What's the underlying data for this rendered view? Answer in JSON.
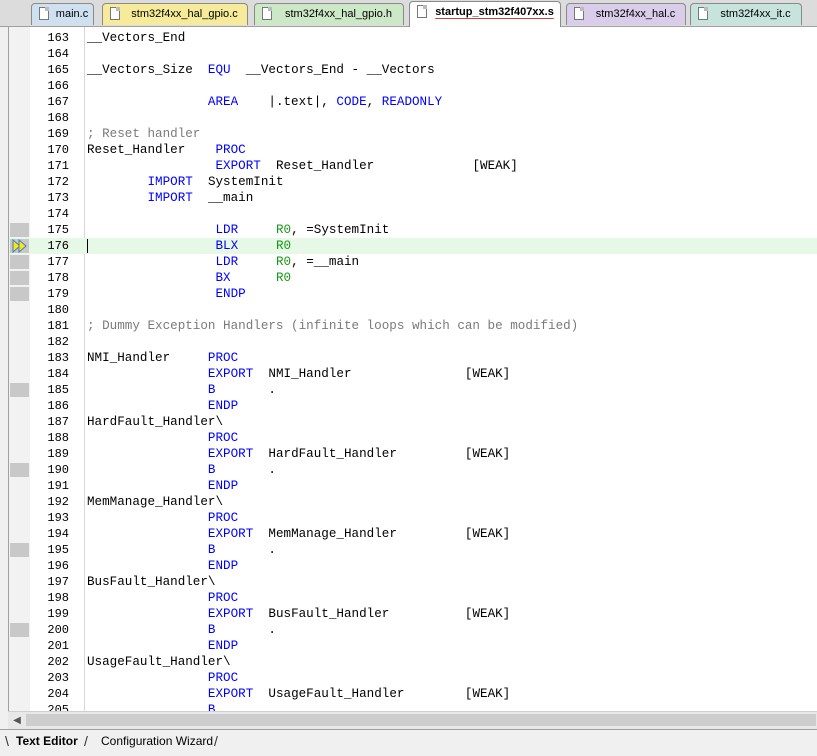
{
  "tabs": [
    {
      "label": "main.c",
      "color": "#cfe0f0",
      "active": false
    },
    {
      "label": "stm32f4xx_hal_gpio.c",
      "color": "#f5eb9a",
      "active": false
    },
    {
      "label": "stm32f4xx_hal_gpio.h",
      "color": "#cde8c6",
      "active": false
    },
    {
      "label": "startup_stm32f407xx.s",
      "color": "#ffffff",
      "active": true
    },
    {
      "label": "stm32f4xx_hal.c",
      "color": "#d9cdea",
      "active": false
    },
    {
      "label": "stm32f4xx_it.c",
      "color": "#c7e4dc",
      "active": false
    }
  ],
  "editor": {
    "current_line": 176,
    "lines": [
      {
        "n": "163",
        "t": [
          [
            "",
            "__Vectors_End"
          ]
        ]
      },
      {
        "n": "164",
        "t": []
      },
      {
        "n": "165",
        "t": [
          [
            "",
            "__Vectors_Size  "
          ],
          [
            "kw",
            "EQU"
          ],
          [
            "",
            "  __Vectors_End - __Vectors"
          ]
        ]
      },
      {
        "n": "166",
        "t": []
      },
      {
        "n": "167",
        "t": [
          [
            "",
            "                "
          ],
          [
            "kw",
            "AREA"
          ],
          [
            "",
            "    |.text|, "
          ],
          [
            "kw",
            "CODE"
          ],
          [
            "",
            ", "
          ],
          [
            "kw",
            "READONLY"
          ]
        ]
      },
      {
        "n": "168",
        "t": []
      },
      {
        "n": "169",
        "t": [
          [
            "cm",
            "; Reset handler"
          ]
        ]
      },
      {
        "n": "170",
        "t": [
          [
            "",
            "Reset_Handler    "
          ],
          [
            "kw",
            "PROC"
          ]
        ]
      },
      {
        "n": "171",
        "t": [
          [
            "",
            "                 "
          ],
          [
            "kw",
            "EXPORT"
          ],
          [
            "",
            "  Reset_Handler             [WEAK]"
          ]
        ]
      },
      {
        "n": "172",
        "t": [
          [
            "",
            "        "
          ],
          [
            "kw",
            "IMPORT"
          ],
          [
            "",
            "  SystemInit"
          ]
        ]
      },
      {
        "n": "173",
        "t": [
          [
            "",
            "        "
          ],
          [
            "kw",
            "IMPORT"
          ],
          [
            "",
            "  __main"
          ]
        ]
      },
      {
        "n": "174",
        "t": []
      },
      {
        "n": "175",
        "bp": true,
        "t": [
          [
            "",
            "                 "
          ],
          [
            "kw",
            "LDR"
          ],
          [
            "",
            "     "
          ],
          [
            "reg",
            "R0"
          ],
          [
            "",
            ", =SystemInit"
          ]
        ]
      },
      {
        "n": "176",
        "bp": true,
        "t": [
          [
            "",
            "                 "
          ],
          [
            "kw",
            "BLX"
          ],
          [
            "",
            "     "
          ],
          [
            "reg",
            "R0"
          ]
        ]
      },
      {
        "n": "177",
        "bp": true,
        "t": [
          [
            "",
            "                 "
          ],
          [
            "kw",
            "LDR"
          ],
          [
            "",
            "     "
          ],
          [
            "reg",
            "R0"
          ],
          [
            "",
            ", =__main"
          ]
        ]
      },
      {
        "n": "178",
        "bp": true,
        "t": [
          [
            "",
            "                 "
          ],
          [
            "kw",
            "BX"
          ],
          [
            "",
            "      "
          ],
          [
            "reg",
            "R0"
          ]
        ]
      },
      {
        "n": "179",
        "bp": true,
        "t": [
          [
            "",
            "                 "
          ],
          [
            "kw",
            "ENDP"
          ]
        ]
      },
      {
        "n": "180",
        "t": []
      },
      {
        "n": "181",
        "t": [
          [
            "cm",
            "; Dummy Exception Handlers (infinite loops which can be modified)"
          ]
        ]
      },
      {
        "n": "182",
        "t": []
      },
      {
        "n": "183",
        "t": [
          [
            "",
            "NMI_Handler     "
          ],
          [
            "kw",
            "PROC"
          ]
        ]
      },
      {
        "n": "184",
        "t": [
          [
            "",
            "                "
          ],
          [
            "kw",
            "EXPORT"
          ],
          [
            "",
            "  NMI_Handler               [WEAK]"
          ]
        ]
      },
      {
        "n": "185",
        "bp": true,
        "t": [
          [
            "",
            "                "
          ],
          [
            "kw",
            "B"
          ],
          [
            "",
            "       ."
          ]
        ]
      },
      {
        "n": "186",
        "t": [
          [
            "",
            "                "
          ],
          [
            "kw",
            "ENDP"
          ]
        ]
      },
      {
        "n": "187",
        "t": [
          [
            "",
            "HardFault_Handler\\"
          ]
        ]
      },
      {
        "n": "188",
        "t": [
          [
            "",
            "                "
          ],
          [
            "kw",
            "PROC"
          ]
        ]
      },
      {
        "n": "189",
        "t": [
          [
            "",
            "                "
          ],
          [
            "kw",
            "EXPORT"
          ],
          [
            "",
            "  HardFault_Handler         [WEAK]"
          ]
        ]
      },
      {
        "n": "190",
        "bp": true,
        "t": [
          [
            "",
            "                "
          ],
          [
            "kw",
            "B"
          ],
          [
            "",
            "       ."
          ]
        ]
      },
      {
        "n": "191",
        "t": [
          [
            "",
            "                "
          ],
          [
            "kw",
            "ENDP"
          ]
        ]
      },
      {
        "n": "192",
        "t": [
          [
            "",
            "MemManage_Handler\\"
          ]
        ]
      },
      {
        "n": "193",
        "t": [
          [
            "",
            "                "
          ],
          [
            "kw",
            "PROC"
          ]
        ]
      },
      {
        "n": "194",
        "t": [
          [
            "",
            "                "
          ],
          [
            "kw",
            "EXPORT"
          ],
          [
            "",
            "  MemManage_Handler         [WEAK]"
          ]
        ]
      },
      {
        "n": "195",
        "bp": true,
        "t": [
          [
            "",
            "                "
          ],
          [
            "kw",
            "B"
          ],
          [
            "",
            "       ."
          ]
        ]
      },
      {
        "n": "196",
        "t": [
          [
            "",
            "                "
          ],
          [
            "kw",
            "ENDP"
          ]
        ]
      },
      {
        "n": "197",
        "t": [
          [
            "",
            "BusFault_Handler\\"
          ]
        ]
      },
      {
        "n": "198",
        "t": [
          [
            "",
            "                "
          ],
          [
            "kw",
            "PROC"
          ]
        ]
      },
      {
        "n": "199",
        "t": [
          [
            "",
            "                "
          ],
          [
            "kw",
            "EXPORT"
          ],
          [
            "",
            "  BusFault_Handler          [WEAK]"
          ]
        ]
      },
      {
        "n": "200",
        "bp": true,
        "t": [
          [
            "",
            "                "
          ],
          [
            "kw",
            "B"
          ],
          [
            "",
            "       ."
          ]
        ]
      },
      {
        "n": "201",
        "t": [
          [
            "",
            "                "
          ],
          [
            "kw",
            "ENDP"
          ]
        ]
      },
      {
        "n": "202",
        "t": [
          [
            "",
            "UsageFault_Handler\\"
          ]
        ]
      },
      {
        "n": "203",
        "t": [
          [
            "",
            "                "
          ],
          [
            "kw",
            "PROC"
          ]
        ]
      },
      {
        "n": "204",
        "t": [
          [
            "",
            "                "
          ],
          [
            "kw",
            "EXPORT"
          ],
          [
            "",
            "  UsageFault_Handler        [WEAK]"
          ]
        ]
      },
      {
        "n": "205",
        "t": [
          [
            "",
            "                "
          ],
          [
            "kw",
            "B"
          ]
        ]
      }
    ]
  },
  "bottom_tabs": [
    {
      "label": "Text Editor",
      "active": true
    },
    {
      "label": "Configuration Wizard",
      "active": false
    }
  ]
}
